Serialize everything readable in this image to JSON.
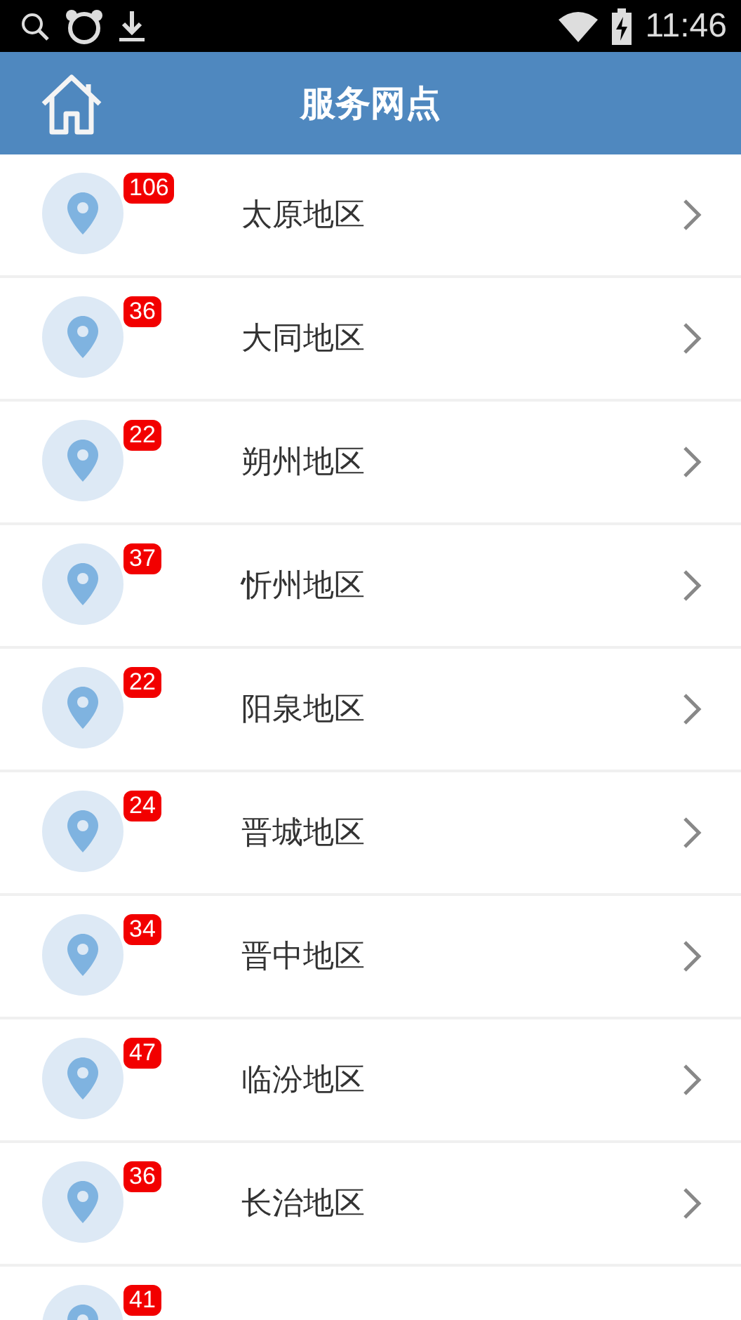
{
  "status_bar": {
    "time": "11:46"
  },
  "header": {
    "title": "服务网点"
  },
  "regions": [
    {
      "name": "太原地区",
      "count": "106"
    },
    {
      "name": "大同地区",
      "count": "36"
    },
    {
      "name": "朔州地区",
      "count": "22"
    },
    {
      "name": "忻州地区",
      "count": "37"
    },
    {
      "name": "阳泉地区",
      "count": "22"
    },
    {
      "name": "晋城地区",
      "count": "24"
    },
    {
      "name": "晋中地区",
      "count": "34"
    },
    {
      "name": "临汾地区",
      "count": "47"
    },
    {
      "name": "长治地区",
      "count": "36"
    },
    {
      "count": "41"
    }
  ]
}
